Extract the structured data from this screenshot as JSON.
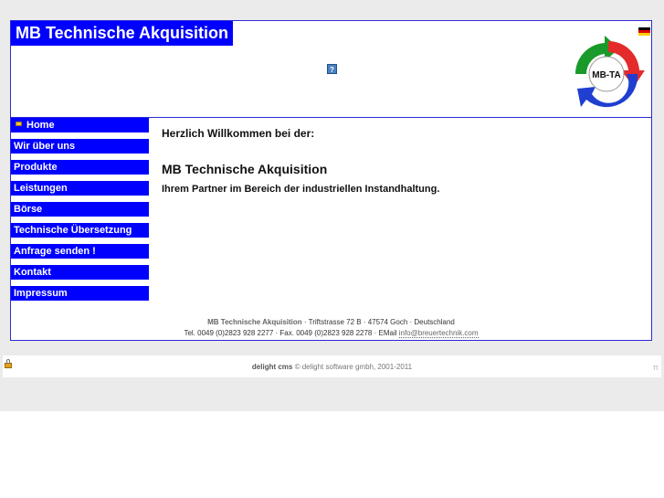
{
  "header": {
    "title": "MB Technische Akquisition",
    "help_label": "?",
    "logo_text": "MB-TA",
    "flag_colors": [
      "#000000",
      "#dd0000",
      "#ffce00"
    ]
  },
  "nav": {
    "items": [
      {
        "label": "Home"
      },
      {
        "label": "Wir über uns"
      },
      {
        "label": "Produkte"
      },
      {
        "label": "Leistungen"
      },
      {
        "label": "Börse"
      },
      {
        "label": "Technische Übersetzung"
      },
      {
        "label": "Anfrage senden !"
      },
      {
        "label": "Kontakt"
      },
      {
        "label": "Impressum"
      }
    ]
  },
  "content": {
    "welcome": "Herzlich Willkommen bei der:",
    "company": "MB Technische Akquisition",
    "partner": "Ihrem Partner im Bereich der industriellen Instandhaltung."
  },
  "footer": {
    "name": "MB Technische Akquisition",
    "address": " · Triftstrasse 72 B · 47574 Goch · Deutschland",
    "contact": "Tel. 0049 (0)2823 928 2277 · Fax. 0049 (0)2823 928 2278 · EMail ",
    "email": "info@breuertechnik.com"
  },
  "cms_bar": {
    "brand": "delight cms",
    "copyright": " © delight software gmbh, 2001-2011",
    "pi": "π"
  },
  "colors": {
    "nav_bg": "#0000ff",
    "border": "#2b2bd6",
    "logo_red": "#e32b2b",
    "logo_green": "#1a9a2a",
    "logo_blue": "#1f3fd0"
  }
}
